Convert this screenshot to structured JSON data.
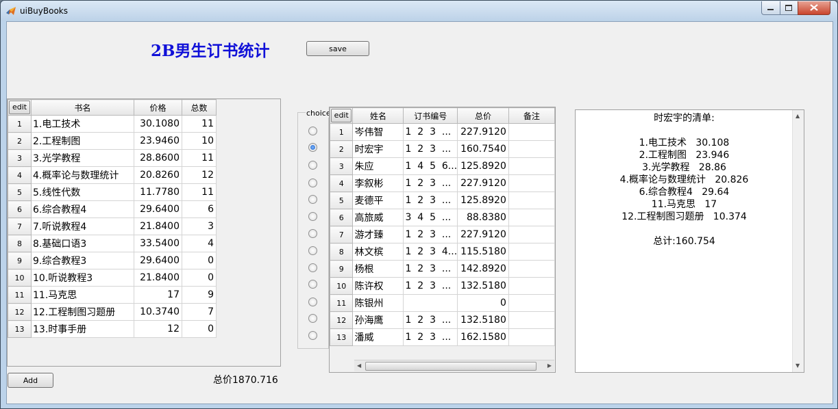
{
  "window": {
    "title": "uiBuyBooks"
  },
  "header": {
    "title": "2B男生订书统计",
    "save_label": "save"
  },
  "books": {
    "edit_label": "edit",
    "columns": [
      "书名",
      "价格",
      "总数"
    ],
    "rows": [
      {
        "n": "1",
        "name": "1.电工技术",
        "price": "30.1080",
        "count": "11"
      },
      {
        "n": "2",
        "name": "2.工程制图",
        "price": "23.9460",
        "count": "10"
      },
      {
        "n": "3",
        "name": "3.光学教程",
        "price": "28.8600",
        "count": "11"
      },
      {
        "n": "4",
        "name": "4.概率论与数理统计",
        "price": "20.8260",
        "count": "12"
      },
      {
        "n": "5",
        "name": "5.线性代数",
        "price": "11.7780",
        "count": "11"
      },
      {
        "n": "6",
        "name": "6.综合教程4",
        "price": "29.6400",
        "count": "6"
      },
      {
        "n": "7",
        "name": "7.听说教程4",
        "price": "21.8400",
        "count": "3"
      },
      {
        "n": "8",
        "name": "8.基础口语3",
        "price": "33.5400",
        "count": "4"
      },
      {
        "n": "9",
        "name": "9.综合教程3",
        "price": "29.6400",
        "count": "0"
      },
      {
        "n": "10",
        "name": "10.听说教程3",
        "price": "21.8400",
        "count": "0"
      },
      {
        "n": "11",
        "name": "11.马克思",
        "price": "17",
        "count": "9"
      },
      {
        "n": "12",
        "name": "12.工程制图习题册",
        "price": "10.3740",
        "count": "7"
      },
      {
        "n": "13",
        "name": "13.时事手册",
        "price": "12",
        "count": "0"
      }
    ],
    "add_label": "Add",
    "total_label": "总价1870.716"
  },
  "choice": {
    "label": "choice",
    "selected_index": 1,
    "count": 13
  },
  "students": {
    "edit_label": "edit",
    "columns": [
      "姓名",
      "订书编号",
      "总价",
      "备注"
    ],
    "rows": [
      {
        "n": "1",
        "name": "岑伟智",
        "ids": "1  2  3  ...",
        "total": "227.9120",
        "note": ""
      },
      {
        "n": "2",
        "name": "时宏宇",
        "ids": "1  2  3  ...",
        "total": "160.7540",
        "note": ""
      },
      {
        "n": "3",
        "name": "朱应",
        "ids": "1  4  5  6...",
        "total": "125.8920",
        "note": ""
      },
      {
        "n": "4",
        "name": "李叙彬",
        "ids": "1  2  3  ...",
        "total": "227.9120",
        "note": ""
      },
      {
        "n": "5",
        "name": "麦德平",
        "ids": "1  2  3  ...",
        "total": "125.8920",
        "note": ""
      },
      {
        "n": "6",
        "name": "高旅威",
        "ids": "3  4  5  ...",
        "total": "88.8380",
        "note": ""
      },
      {
        "n": "7",
        "name": "游才臻",
        "ids": "1  2  3  ...",
        "total": "227.9120",
        "note": ""
      },
      {
        "n": "8",
        "name": "林文槟",
        "ids": "1  2  3  4...",
        "total": "115.5180",
        "note": ""
      },
      {
        "n": "9",
        "name": "杨根",
        "ids": "1  2  3  ...",
        "total": "142.8920",
        "note": ""
      },
      {
        "n": "10",
        "name": "陈许权",
        "ids": "1  2  3  ...",
        "total": "132.5180",
        "note": ""
      },
      {
        "n": "11",
        "name": "陈银州",
        "ids": "",
        "total": "0",
        "note": ""
      },
      {
        "n": "12",
        "name": "孙海鹰",
        "ids": "1  2  3  ...",
        "total": "132.5180",
        "note": ""
      },
      {
        "n": "13",
        "name": "潘威",
        "ids": "1  2  3  ...",
        "total": "162.1580",
        "note": ""
      }
    ]
  },
  "receipt": {
    "lines": [
      "时宏宇的清单:",
      "",
      "1.电工技术   30.108",
      "2.工程制图   23.946",
      "3.光学教程   28.86",
      "4.概率论与数理统计   20.826",
      "6.综合教程4   29.64",
      "11.马克思   17",
      "12.工程制图习题册   10.374",
      "",
      "总计:160.754"
    ]
  },
  "colors": {
    "heading": "#1010d8",
    "titlebar": "#bcd2e8",
    "close_button": "#c9452d",
    "radio_selected": "#1a5fc4"
  }
}
